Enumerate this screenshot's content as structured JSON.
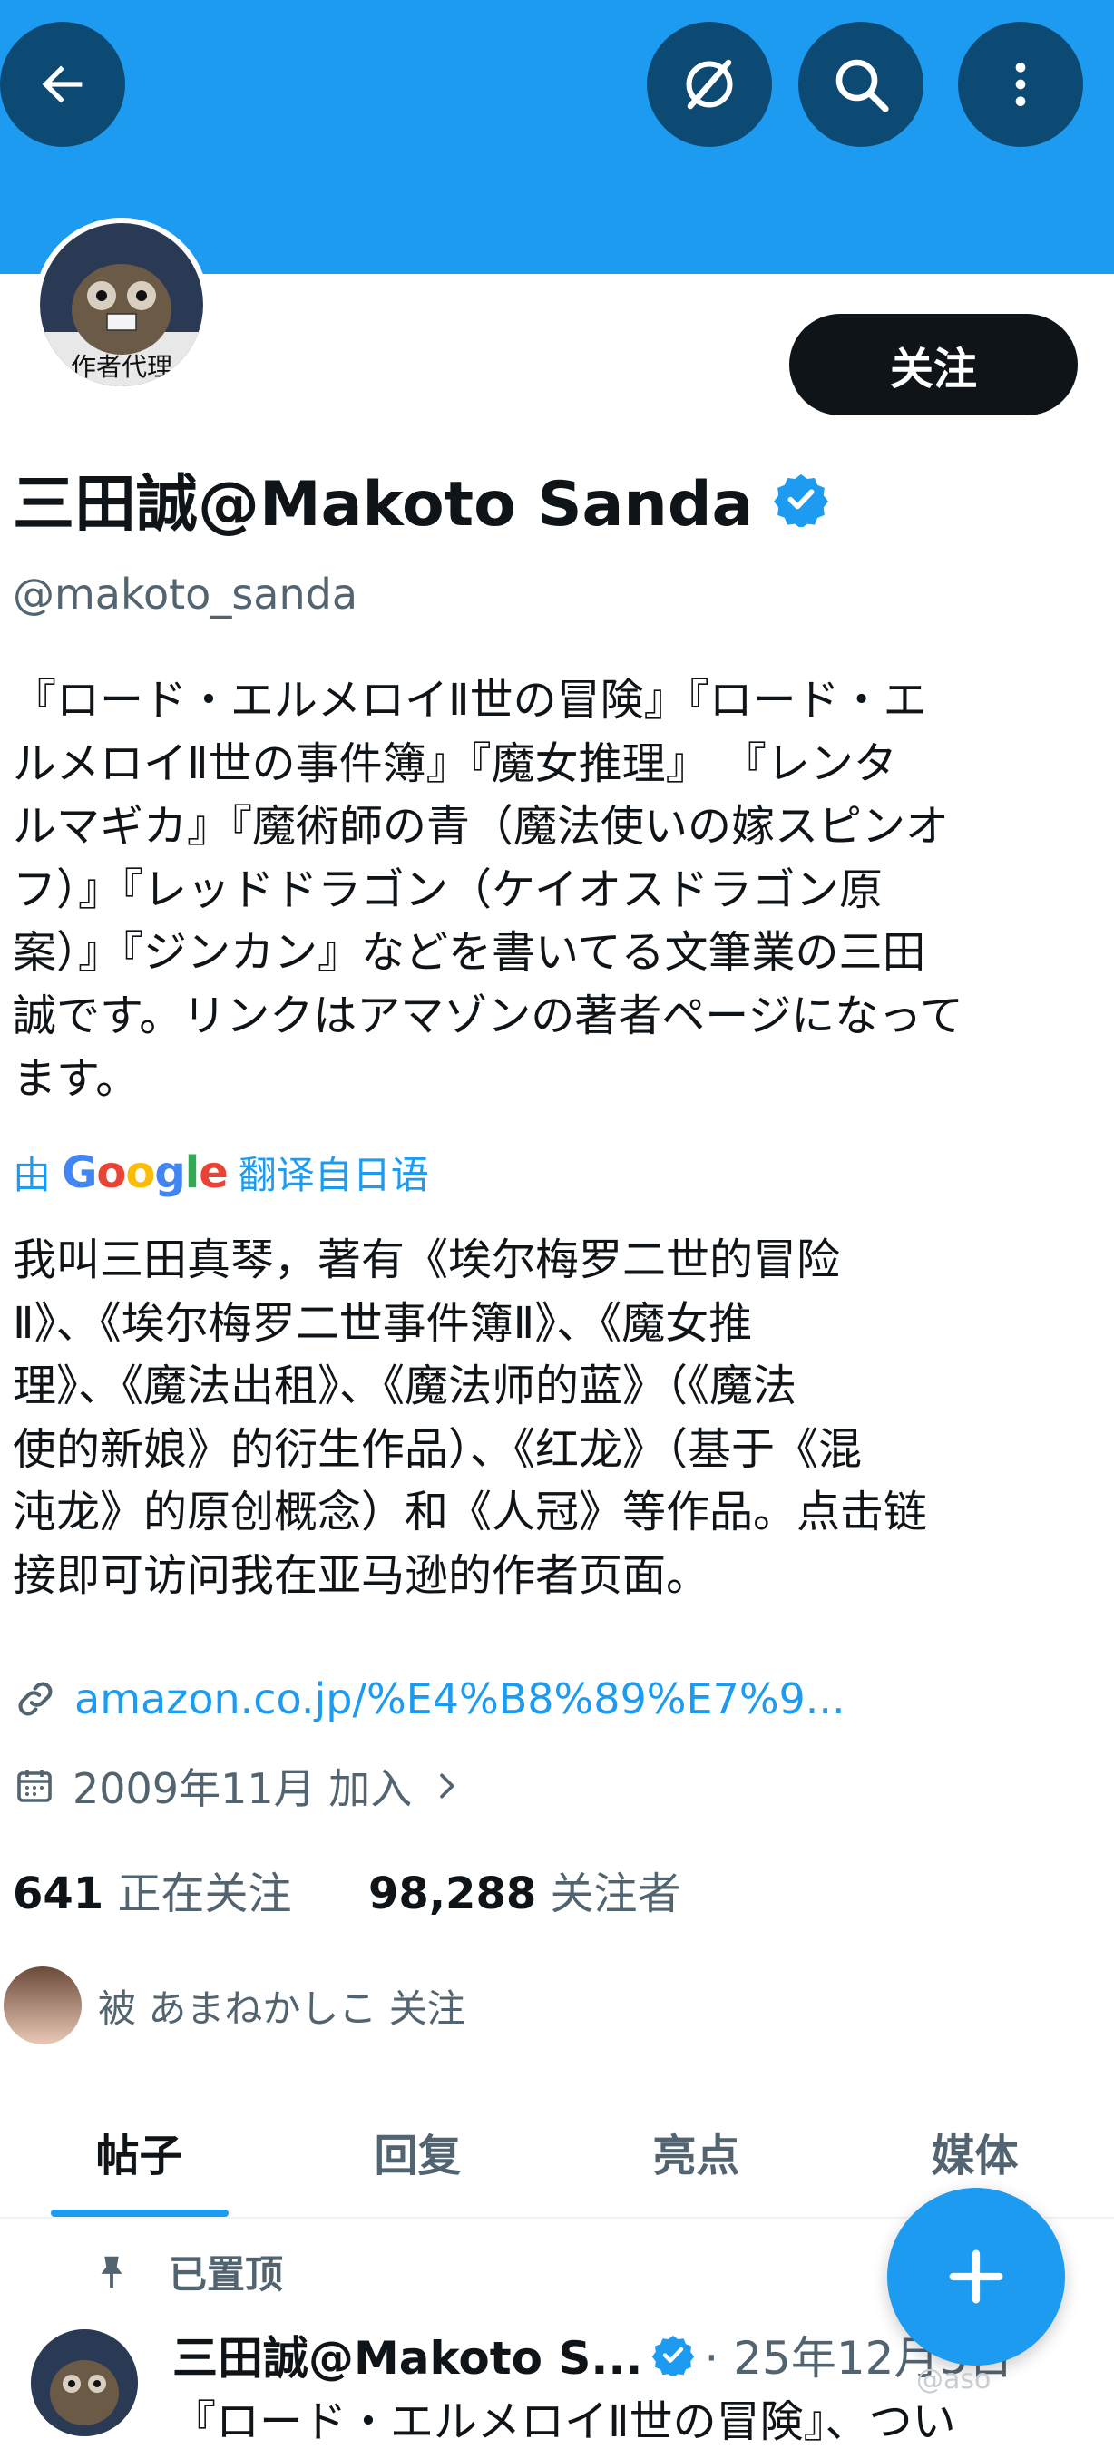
{
  "header": {
    "back_icon": "arrow-left-icon",
    "grok_icon": "grok-icon",
    "search_icon": "search-icon",
    "more_icon": "more-vertical-icon",
    "banner_color": "#1d9bf0"
  },
  "profile": {
    "avatar_text": "作者代理",
    "follow_label": "关注",
    "name": "三田誠@Makoto Sanda",
    "verified_icon": "verified-badge-icon",
    "handle": "@makoto_sanda",
    "bio_lines": [
      "『ロード・エルメロイⅡ世の冒険』『ロード・エ",
      "ルメロイⅡ世の事件簿』『魔女推理』 『レンタ",
      "ルマギカ』『魔術師の青（魔法使いの嫁スピンオ",
      "フ）』『レッドドラゴン（ケイオスドラゴン原",
      "案）』『ジンカン』などを書いてる文筆業の三田",
      "誠です。リンクはアマゾンの著者ページになって",
      "ます。"
    ],
    "translate_prefix": "由",
    "translate_brand": "Google",
    "translate_suffix": "翻译自日语",
    "translated_lines": [
      "我叫三田真琴，著有《埃尔梅罗二世的冒险",
      "Ⅱ》、《埃尔梅罗二世事件簿Ⅱ》、《魔女推",
      "理》、《魔法出租》、《魔法师的蓝》（《魔法",
      "使的新娘》的衍生作品）、《红龙》（基于《混",
      "沌龙》的原创概念）和《人冠》等作品。点击链",
      "接即可访问我在亚马逊的作者页面。"
    ],
    "link": "amazon.co.jp/%E4%B8%89%E7%9...",
    "link_icon": "link-icon",
    "joined": "2009年11月 加入",
    "calendar_icon": "calendar-icon",
    "chevron_icon": "chevron-right-icon",
    "following_count": "641",
    "following_label": "正在关注",
    "followers_count": "98,288",
    "followers_label": "关注者",
    "followed_by": "被 あまねかしこ 关注"
  },
  "tabs": [
    {
      "label": "帖子"
    },
    {
      "label": "回复"
    },
    {
      "label": "亮点"
    },
    {
      "label": "媒体"
    }
  ],
  "post": {
    "pinned_label": "已置顶",
    "pin_icon": "pin-icon",
    "author": "三田誠@Makoto S...",
    "date": "· 25年12月5日",
    "text_preview": "『ロード・エルメロイⅡ世の冒険』、つい"
  },
  "fab": {
    "icon": "plus-icon"
  },
  "watermark": "@aso"
}
